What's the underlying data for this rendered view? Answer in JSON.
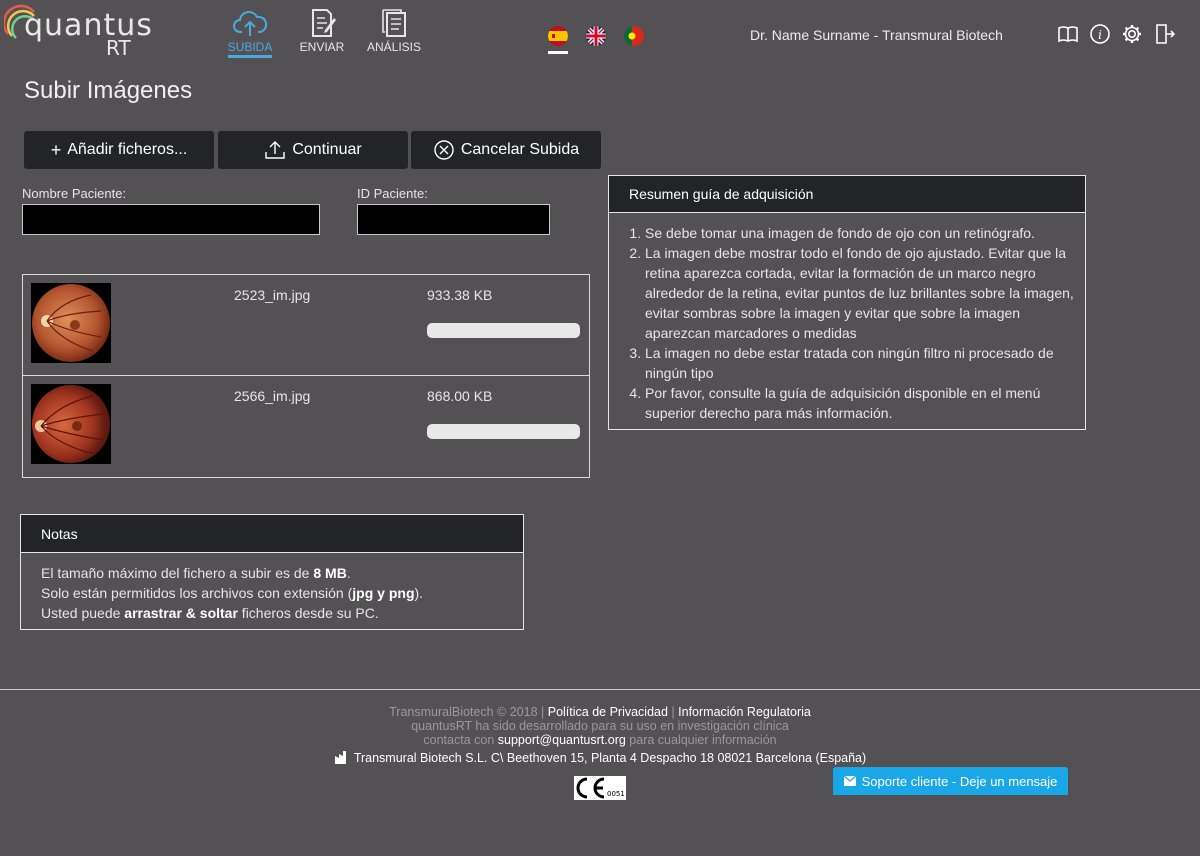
{
  "logo": {
    "word": "quantus",
    "suffix": "RT"
  },
  "nav": [
    {
      "label": "SUBIDA",
      "icon": "cloud-upload-icon",
      "active": true
    },
    {
      "label": "ENVIAR",
      "icon": "send-document-icon",
      "active": false
    },
    {
      "label": "ANÁLISIS",
      "icon": "analysis-document-icon",
      "active": false
    }
  ],
  "languages": [
    "es",
    "en",
    "pt"
  ],
  "user": "Dr. Name Surname - Transmural Biotech",
  "tools": [
    "book-icon",
    "info-icon",
    "gear-icon",
    "logout-icon"
  ],
  "page": {
    "title": "Subir Imágenes"
  },
  "buttons": {
    "add": "Añadir ficheros...",
    "continue": "Continuar",
    "cancel": "Cancelar Subida"
  },
  "form": {
    "patient_name_label": "Nombre Paciente:",
    "patient_name_value": "",
    "patient_id_label": "ID Paciente:",
    "patient_id_value": ""
  },
  "files": [
    {
      "name": "2523_im.jpg",
      "size": "933.38 KB",
      "progress": 0
    },
    {
      "name": "2566_im.jpg",
      "size": "868.00 KB",
      "progress": 0
    }
  ],
  "guide": {
    "title": "Resumen guía de adquisición",
    "items": [
      "Se debe tomar una imagen de fondo de ojo con un retinógrafo.",
      "La imagen debe mostrar todo el fondo de ojo ajustado. Evitar que la retina aparezca cortada, evitar la formación de un marco negro alrededor de la retina, evitar puntos de luz brillantes sobre la imagen, evitar sombras sobre la imagen y evitar que sobre la imagen aparezcan marcadores o medidas",
      "La imagen no debe estar tratada con ningún filtro ni procesado de ningún tipo",
      "Por favor, consulte la guía de adquisición disponible en el menú superior derecho para más información."
    ]
  },
  "notes": {
    "title": "Notas",
    "line1_pre": "El tamaño máximo del fichero a subir es de ",
    "line1_bold": "8 MB",
    "line1_post": ".",
    "line2_pre": "Solo están permitidos los archivos con extensión (",
    "line2_bold": "jpg y png",
    "line2_post": ").",
    "line3_pre": "Usted puede ",
    "line3_bold": "arrastrar & soltar",
    "line3_post": " ficheros desde su PC."
  },
  "footer": {
    "copyright": "TransmuralBiotech © 2018 |",
    "privacy": "Política de Privacidad",
    "sep": "|",
    "regulatory": "Información Regulatoria",
    "line2": "quantusRT ha sido desarrollado para su uso en investigación clínica",
    "contact_pre": "contacta con",
    "email": "support@quantusrt.org",
    "contact_post": "para cualquier información",
    "address": "Transmural Biotech S.L. C\\ Beethoven 15, Planta 4 Despacho 18 08021 Barcelona (España)",
    "ce_number": "0051"
  },
  "support": {
    "label": "Soporte cliente - Deje un mensaje"
  },
  "colors": {
    "background": "#535153",
    "dark": "#232428",
    "accent": "#4aa9e0",
    "support": "#1aa7e8"
  }
}
